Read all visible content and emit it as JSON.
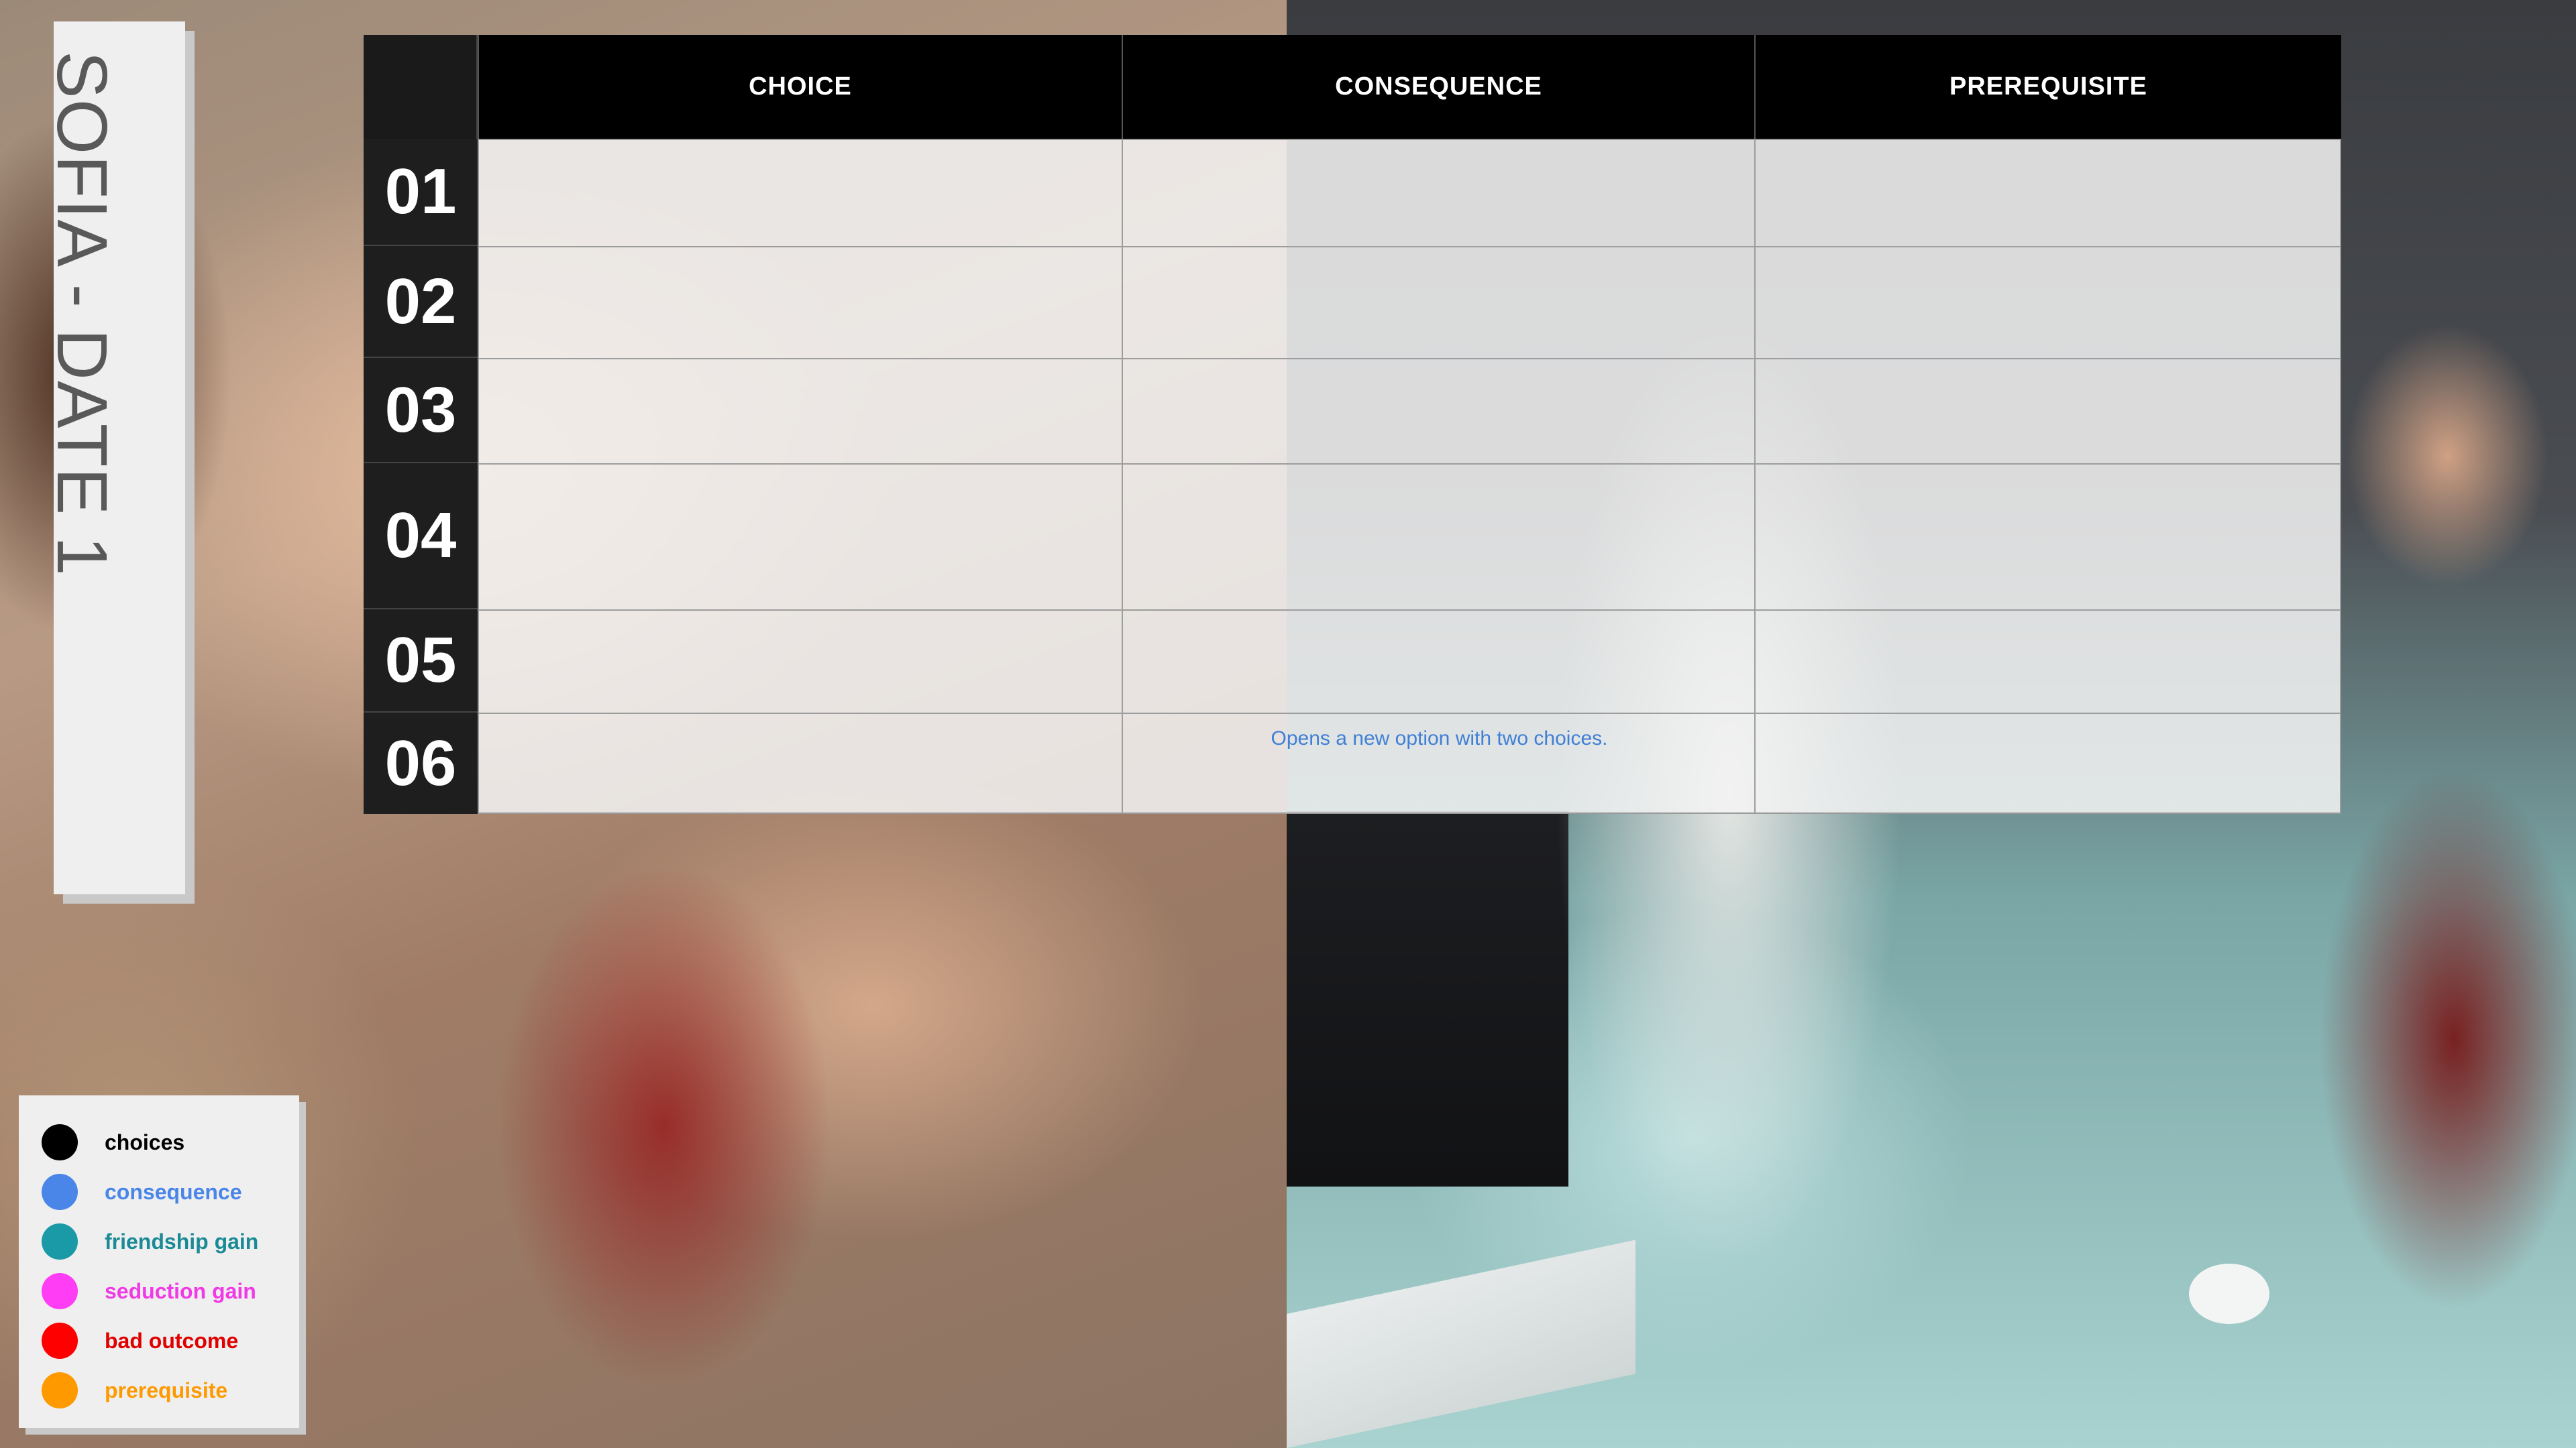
{
  "title": "SOFIA - DATE 1",
  "table": {
    "headers": {
      "choice": "CHOICE",
      "consequence": "CONSEQUENCE",
      "prerequisite": "PREREQUISITE"
    },
    "rows": [
      {
        "number": "01",
        "choice": "",
        "consequence": "",
        "prerequisite": ""
      },
      {
        "number": "02",
        "choice": "",
        "consequence": "",
        "prerequisite": ""
      },
      {
        "number": "03",
        "choice": "",
        "consequence": "",
        "prerequisite": ""
      },
      {
        "number": "04",
        "choice": "",
        "consequence": "",
        "prerequisite": ""
      },
      {
        "number": "05",
        "choice": "",
        "consequence": "",
        "prerequisite": ""
      },
      {
        "number": "06",
        "choice": "",
        "consequence": "Opens a new option with two choices.",
        "prerequisite": ""
      }
    ]
  },
  "legend": [
    {
      "label": "choices",
      "color": "#000000"
    },
    {
      "label": "consequence",
      "color": "#4a86e8"
    },
    {
      "label": "friendship gain",
      "color": "#1a9aa6"
    },
    {
      "label": "seduction gain",
      "color": "#ff3df5"
    },
    {
      "label": "bad outcome",
      "color": "#ff0000"
    },
    {
      "label": "prerequisite",
      "color": "#ff9900"
    }
  ]
}
